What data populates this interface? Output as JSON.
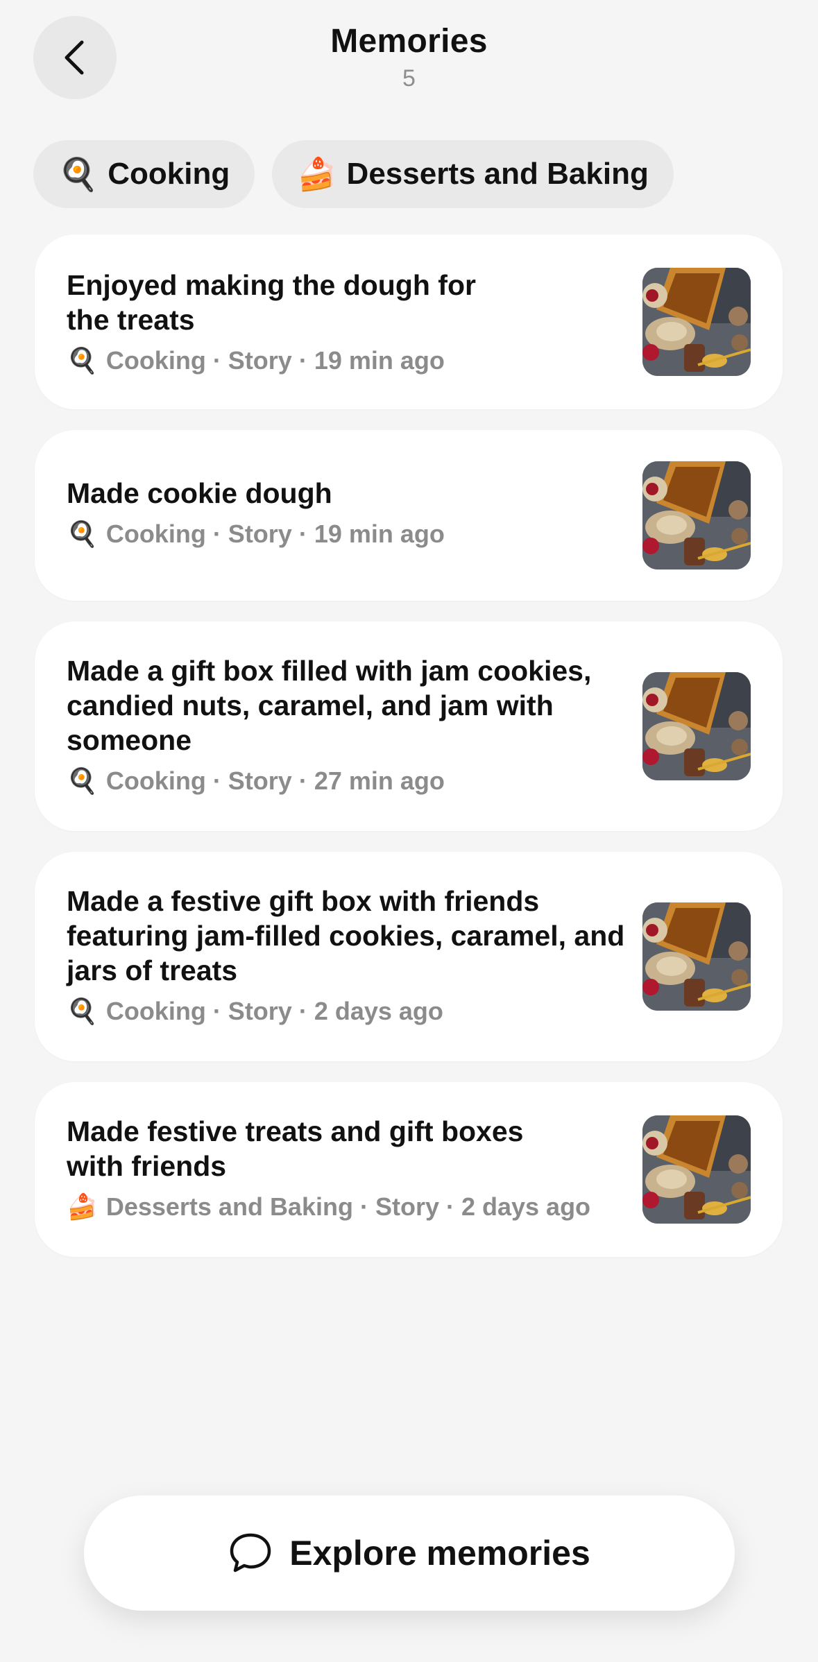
{
  "header": {
    "title": "Memories",
    "count": "5",
    "back_icon": "chevron-left-icon"
  },
  "filters": [
    {
      "emoji": "🍳",
      "label": "Cooking"
    },
    {
      "emoji": "🍰",
      "label": "Desserts and Baking"
    }
  ],
  "memories": [
    {
      "title": "Enjoyed making the dough for the treats",
      "emoji": "🍳",
      "meta": "Cooking · Story · 19 min ago"
    },
    {
      "title": "Made cookie dough",
      "emoji": "🍳",
      "meta": "Cooking · Story · 19 min ago"
    },
    {
      "title": "Made a gift box filled with jam cookies, candied nuts, caramel, and jam with someone",
      "emoji": "🍳",
      "meta": "Cooking · Story · 27 min ago"
    },
    {
      "title": "Made a festive gift box with friends featuring jam-filled cookies, caramel, and jars of treats",
      "emoji": "🍳",
      "meta": "Cooking · Story · 2 days ago"
    },
    {
      "title": "Made festive treats and gift boxes with friends",
      "emoji": "🍰",
      "meta": "Desserts and Baking · Story · 2 days ago"
    }
  ],
  "explore_button": {
    "label": "Explore memories",
    "icon": "chat-bubble-icon"
  }
}
